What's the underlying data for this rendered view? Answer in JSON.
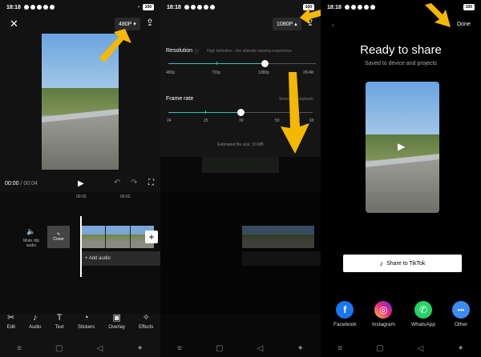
{
  "status_bar": {
    "time": "18:18",
    "battery": "100"
  },
  "panel1": {
    "resolution_badge": "480P",
    "timecode_current": "00:00",
    "timecode_sep": " / ",
    "timecode_total": "00:04",
    "ruler": [
      "00:00",
      "00:02"
    ],
    "mute_label": "Mute clip audio",
    "cover_label": "Cover",
    "add_audio_label": "+ Add audio",
    "tools": [
      {
        "icon": "scissors-icon",
        "label": "Edit"
      },
      {
        "icon": "music-note-icon",
        "label": "Audio"
      },
      {
        "icon": "text-icon",
        "label": "Text"
      },
      {
        "icon": "sticker-icon",
        "label": "Stickers"
      },
      {
        "icon": "overlay-icon",
        "label": "Overlay"
      },
      {
        "icon": "effects-icon",
        "label": "Effects"
      }
    ]
  },
  "panel2": {
    "resolution_badge": "1080P",
    "resolution_title": "Resolution",
    "resolution_hint": "High definition - the ultimate viewing experience",
    "resolution_options": [
      "480p",
      "720p",
      "1080p",
      "2K/4K"
    ],
    "resolution_selected_index": 2,
    "framerate_title": "Frame rate",
    "framerate_hint": "Smoother playback",
    "framerate_options": [
      "24",
      "25",
      "30",
      "50",
      "60"
    ],
    "framerate_selected_index": 2,
    "file_size": "Estimated file size: 10 MB"
  },
  "panel3": {
    "done_label": "Done",
    "title": "Ready to share",
    "subtitle": "Saved to device and projects",
    "share_tiktok": "Share to TikTok",
    "socials": [
      {
        "name": "Facebook",
        "color": "#1877f2",
        "glyph": "f"
      },
      {
        "name": "Instagram",
        "color": "#d6249f",
        "glyph": "◎"
      },
      {
        "name": "WhatsApp",
        "color": "#25d366",
        "glyph": "✆"
      },
      {
        "name": "Other",
        "color": "#3b8df5",
        "glyph": "•••"
      }
    ]
  },
  "colors": {
    "accent": "#27c6c0",
    "arrow": "#f5b800"
  }
}
